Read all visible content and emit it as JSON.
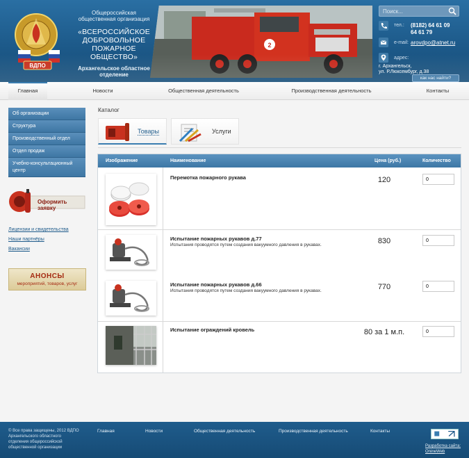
{
  "header": {
    "org_sub": "Общероссийская общественная организация",
    "org_name": "«ВСЕРОССИЙСКОЕ ДОБРОВОЛЬНОЕ ПОЖАРНОЕ ОБЩЕСТВО»",
    "org_branch": "Архангельское областное отделение",
    "emblem_text": "ВДПО",
    "truck_number": "2",
    "search_placeholder": "Поиск...",
    "phone_label": "тел.:",
    "phone_1": "(8182) 64 61 09",
    "phone_2": "64 61 79",
    "email_label": "e-mail:",
    "email": "arovdpo@atnet.ru",
    "address_label": "адрес:",
    "address_1": "г. Архангельск,",
    "address_2": "ул. Р.Люксембург, д.38",
    "find_us": "как нас найти?"
  },
  "nav": {
    "items": [
      "Главная",
      "Новости",
      "Общественная деятельность",
      "Производственная деятельность",
      "Контакты"
    ]
  },
  "sidebar": {
    "menu": [
      "Об организации",
      "Структура",
      "Производственный отдел",
      "Отдел продаж",
      "Учебно-консультационный центр"
    ],
    "order_button": "Оформить заявку",
    "links": [
      "Лицензии и свидетельства",
      "Наши партнёры",
      "Вакансии"
    ],
    "anons_title": "АНОНСЫ",
    "anons_sub": "мероприятий, товаров, услуг"
  },
  "catalog": {
    "title": "Каталог",
    "tabs": [
      "Товары",
      "Услуги"
    ],
    "columns": [
      "Изображение",
      "Наименование",
      "Цена (руб.)",
      "Количество"
    ],
    "rows": [
      {
        "name": "Перемотка пожарного рукава",
        "desc": "",
        "price": "120",
        "qty": "0"
      },
      {
        "name": "Испытание пожарных рукавов д.77",
        "desc": "Испытания проводятся путем создания вакуумного давления в рукавах.",
        "price": "830",
        "qty": "0"
      },
      {
        "name": "Испытание пожарных рукавов д.66",
        "desc": "Испытания проводятся путем создания вакуумного давления в рукавах.",
        "price": "770",
        "qty": "0"
      },
      {
        "name": "Испытание ограждений кровель",
        "desc": "",
        "price": "80 за 1 м.п.",
        "qty": "0"
      }
    ]
  },
  "footer": {
    "copyright": "© Все права защищены, 2012 ВДПО Архангельского областного отделения общероссийской общественной организации",
    "links": [
      "Главная",
      "Новости",
      "Общественная деятельность",
      "Производственная деятельность",
      "Контакты"
    ],
    "developer": "Разработка сайта: OnineWeb"
  }
}
